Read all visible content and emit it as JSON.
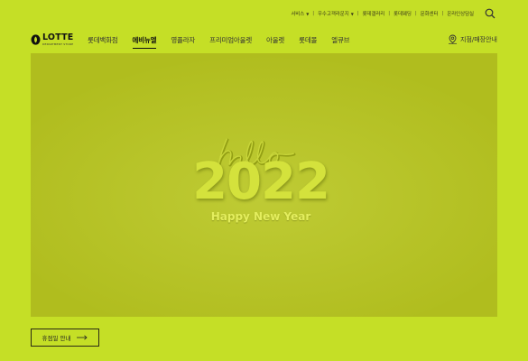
{
  "utility": {
    "service": "서비스",
    "vip": "우수고객라운지",
    "gallery": "롯데갤러리",
    "ecurry": "롯데웨딩",
    "culture": "문화센터",
    "online": "온라인상담실"
  },
  "logo": {
    "word": "LOTTE",
    "sub": "DEPARTMENT STORE"
  },
  "gnb": [
    "롯데백화점",
    "에비뉴엘",
    "영플라자",
    "프리미엄아울렛",
    "아울렛",
    "롯데몰",
    "엘큐브"
  ],
  "store_finder": "지점/매장안내",
  "hero": {
    "script": "hello",
    "year": "2022",
    "tagline": "Happy New Year"
  },
  "notice_button": "휴점일 안내",
  "colors": {
    "page_bg": "#c5df26",
    "hero_bg": "#b0bd1e",
    "hero_text": "#d4e23c"
  }
}
